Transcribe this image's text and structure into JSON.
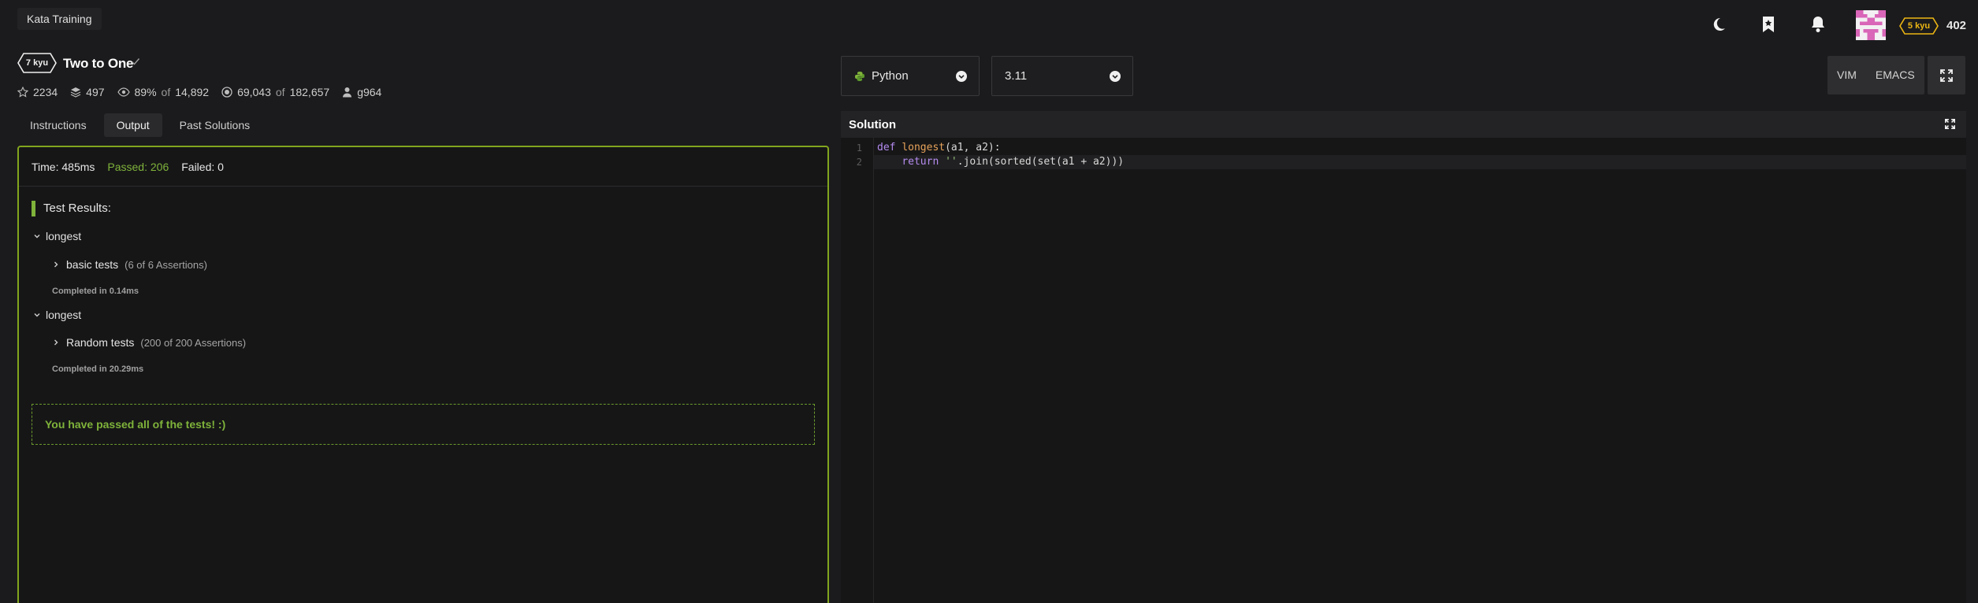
{
  "header": {
    "breadcrumb": "Kata Training",
    "user_rank": "5 kyu",
    "honor": "402",
    "icons": [
      "moon-icon",
      "bookmark-icon",
      "bell-icon"
    ]
  },
  "kata": {
    "kyu": "7 kyu",
    "title": "Two to One",
    "stats": {
      "stars": "2234",
      "collections": "497",
      "satisfaction": "89%",
      "votes_of": "of",
      "votes": "14,892",
      "completed": "69,043",
      "completed_of": "of",
      "attempted": "182,657",
      "author": "g964"
    }
  },
  "tabs": [
    {
      "label": "Instructions",
      "active": false
    },
    {
      "label": "Output",
      "active": true
    },
    {
      "label": "Past Solutions",
      "active": false
    }
  ],
  "output": {
    "time": "Time: 485ms",
    "passed": "Passed: 206",
    "failed": "Failed: 0",
    "results_header": "Test Results:",
    "groups": [
      {
        "name": "longest",
        "test": "basic tests",
        "assertions": "(6 of 6 Assertions)",
        "completed": "Completed in 0.14ms"
      },
      {
        "name": "longest",
        "test": "Random tests",
        "assertions": "(200 of 200 Assertions)",
        "completed": "Completed in 20.29ms"
      }
    ],
    "pass_message": "You have passed all of the tests! :)"
  },
  "editor_controls": {
    "language": "Python",
    "version": "3.11",
    "modes": [
      "VIM",
      "EMACS"
    ]
  },
  "solution": {
    "title": "Solution",
    "lines": [
      {
        "n": "1",
        "code": "def longest(a1, a2):"
      },
      {
        "n": "2",
        "code": "    return ''.join(sorted(set(a1 + a2)))"
      }
    ]
  },
  "colors": {
    "accent_green": "#7fb33a",
    "panel_border": "#82a51e",
    "rank_yellow": "#ecb613"
  }
}
